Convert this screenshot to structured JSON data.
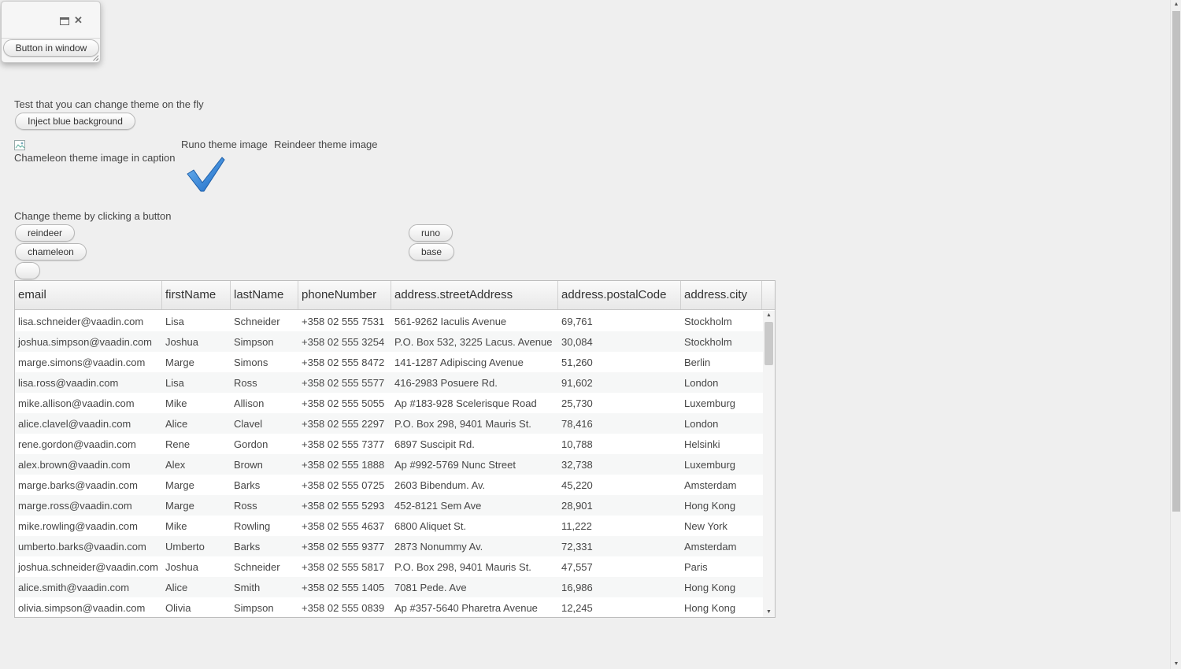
{
  "window": {
    "maximize_icon": "maximize-icon",
    "close_icon": "close-icon",
    "close_glyph": "✕",
    "button_label": "Button in window"
  },
  "intro_text": "Test that you can change theme on the fly",
  "inject_button_label": "Inject blue background",
  "theme_images": {
    "chameleon_caption": "Chameleon theme image in caption",
    "runo_caption": "Runo theme image",
    "reindeer_caption": "Reindeer theme image",
    "check_icon": "checkmark-icon",
    "check_color": "#2c7fd5"
  },
  "change_theme_text": "Change theme by clicking a button",
  "theme_buttons": {
    "reindeer": "reindeer",
    "runo": "runo",
    "chameleon": "chameleon",
    "base": "base",
    "empty": ""
  },
  "table": {
    "columns": [
      "email",
      "firstName",
      "lastName",
      "phoneNumber",
      "address.streetAddress",
      "address.postalCode",
      "address.city"
    ],
    "rows": [
      [
        "lisa.schneider@vaadin.com",
        "Lisa",
        "Schneider",
        "+358 02 555 7531",
        "561-9262 Iaculis Avenue",
        "69,761",
        "Stockholm"
      ],
      [
        "joshua.simpson@vaadin.com",
        "Joshua",
        "Simpson",
        "+358 02 555 3254",
        "P.O. Box 532, 3225 Lacus. Avenue",
        "30,084",
        "Stockholm"
      ],
      [
        "marge.simons@vaadin.com",
        "Marge",
        "Simons",
        "+358 02 555 8472",
        "141-1287 Adipiscing Avenue",
        "51,260",
        "Berlin"
      ],
      [
        "lisa.ross@vaadin.com",
        "Lisa",
        "Ross",
        "+358 02 555 5577",
        "416-2983 Posuere Rd.",
        "91,602",
        "London"
      ],
      [
        "mike.allison@vaadin.com",
        "Mike",
        "Allison",
        "+358 02 555 5055",
        "Ap #183-928 Scelerisque Road",
        "25,730",
        "Luxemburg"
      ],
      [
        "alice.clavel@vaadin.com",
        "Alice",
        "Clavel",
        "+358 02 555 2297",
        "P.O. Box 298, 9401 Mauris St.",
        "78,416",
        "London"
      ],
      [
        "rene.gordon@vaadin.com",
        "Rene",
        "Gordon",
        "+358 02 555 7377",
        "6897 Suscipit Rd.",
        "10,788",
        "Helsinki"
      ],
      [
        "alex.brown@vaadin.com",
        "Alex",
        "Brown",
        "+358 02 555 1888",
        "Ap #992-5769 Nunc Street",
        "32,738",
        "Luxemburg"
      ],
      [
        "marge.barks@vaadin.com",
        "Marge",
        "Barks",
        "+358 02 555 0725",
        "2603 Bibendum. Av.",
        "45,220",
        "Amsterdam"
      ],
      [
        "marge.ross@vaadin.com",
        "Marge",
        "Ross",
        "+358 02 555 5293",
        "452-8121 Sem Ave",
        "28,901",
        "Hong Kong"
      ],
      [
        "mike.rowling@vaadin.com",
        "Mike",
        "Rowling",
        "+358 02 555 4637",
        "6800 Aliquet St.",
        "11,222",
        "New York"
      ],
      [
        "umberto.barks@vaadin.com",
        "Umberto",
        "Barks",
        "+358 02 555 9377",
        "2873 Nonummy Av.",
        "72,331",
        "Amsterdam"
      ],
      [
        "joshua.schneider@vaadin.com",
        "Joshua",
        "Schneider",
        "+358 02 555 5817",
        "P.O. Box 298, 9401 Mauris St.",
        "47,557",
        "Paris"
      ],
      [
        "alice.smith@vaadin.com",
        "Alice",
        "Smith",
        "+358 02 555 1405",
        "7081 Pede. Ave",
        "16,986",
        "Hong Kong"
      ],
      [
        "olivia.simpson@vaadin.com",
        "Olivia",
        "Simpson",
        "+358 02 555 0839",
        "Ap #357-5640 Pharetra Avenue",
        "12,245",
        "Hong Kong"
      ]
    ]
  }
}
